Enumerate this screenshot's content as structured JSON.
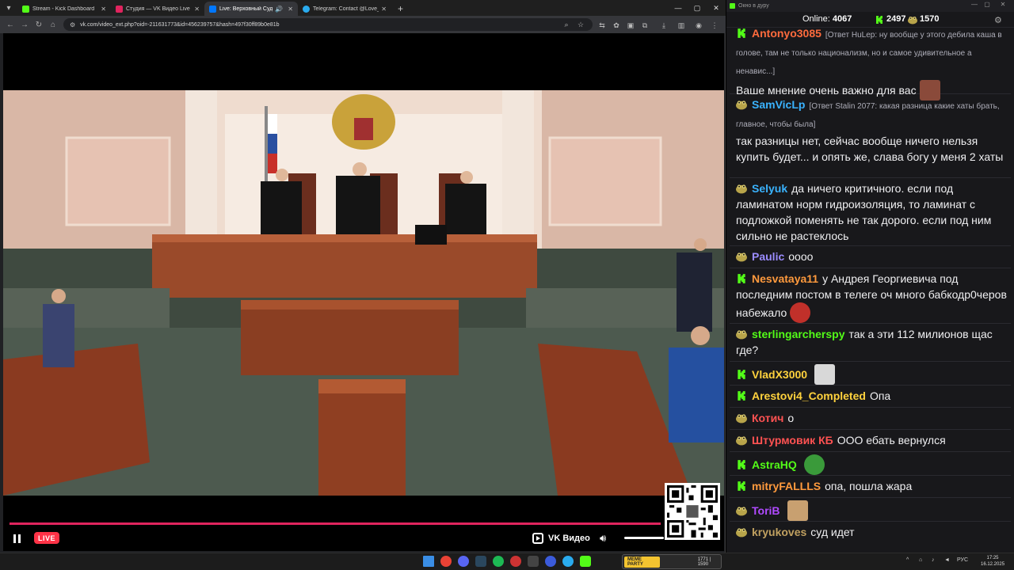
{
  "browser": {
    "tabs": [
      {
        "title": "Stream - Kick Dashboard",
        "color": "#53fc18"
      },
      {
        "title": "Студия — VK Видео Live",
        "color": "#e0245e"
      },
      {
        "title": "Live: Верховный Суд Росс",
        "color": "#0077ff"
      },
      {
        "title": "Telegram: Contact @Love_Russ",
        "color": "#2aabee"
      }
    ],
    "url": "vk.com/video_ext.php?oid=-211631773&id=456239757&hash=497f30ff89b0e81b"
  },
  "video": {
    "live_label": "LIVE",
    "brand_label": "VK Видео",
    "is_live": true,
    "volume_level": 0.8
  },
  "chat": {
    "window_title": "Окно в дуру",
    "online_label": "Online:",
    "online_count": "4067",
    "kick_coins": "2497",
    "frog_coins": "1570",
    "messages": [
      {
        "badge": "kick",
        "user": "Antonyo3085",
        "color": "#ff6b3d",
        "reply": "[Ответ HuLep: ну вообще у этого дебила каша в голове, там не только национализм, но и самое удивительное а ненавис...]",
        "text": "Ваше мнение очень важно для вас",
        "emote": "face-emote"
      },
      {
        "badge": "frog",
        "user": "SamVicLp",
        "color": "#3ab3ff",
        "reply": "[Ответ Stalin 2077: какая разница какие хаты брать, главное, чтобы была]",
        "text": "так разницы нет, сейчас вообще ничего нельзя купить будет... и опять же, слава богу у меня 2 хаты"
      },
      {
        "badge": "frog",
        "user": "Selyuk",
        "color": "#3ab3ff",
        "text": "да ничего критичного. если под ламинатом норм гидроизоляция, то ламинат с подложкой поменять не так дорого. если под ним сильно не растеклось"
      },
      {
        "badge": "frog",
        "user": "Paulic",
        "color": "#9b8cff",
        "text": "оооо"
      },
      {
        "badge": "kick",
        "user": "Nesvataya11",
        "color": "#ff9a3d",
        "text": "у Андрея Георгиевича под последним постом в телеге оч много бабкодр0черов набежало",
        "emote": "red-emote"
      },
      {
        "badge": "frog",
        "user": "sterlingarcherspy",
        "color": "#53fc18",
        "text": "так а эти 112 милионов щас где?"
      },
      {
        "badge": "kick",
        "user": "VladX3000",
        "color": "#ffd23d",
        "text": "",
        "emote": "cat-emote"
      },
      {
        "badge": "kick",
        "user": "Arestovi4_Completed",
        "color": "#ffd23d",
        "text": "Опа"
      },
      {
        "badge": "frog",
        "user": "Котич",
        "color": "#ff5252",
        "text": "о"
      },
      {
        "badge": "frog",
        "user": "Штурмовик КБ",
        "color": "#ff5252",
        "text": "ООО ебать вернулся"
      },
      {
        "badge": "kick",
        "user": "AstraHQ",
        "color": "#53fc18",
        "text": "",
        "emote": "pepe-emote"
      },
      {
        "badge": "kick",
        "user": "mitryFALLLS",
        "color": "#ff9a3d",
        "text": "опа, пошла жара"
      },
      {
        "badge": "frog",
        "user": "ToriB",
        "color": "#b04aff",
        "text": "",
        "emote": "dog-emote"
      },
      {
        "badge": "frog",
        "user": "kryukoves",
        "color": "#c0a060",
        "text": "суд идет"
      }
    ]
  },
  "taskbar": {
    "meme_label": "MEME PARTY",
    "meme_stats": "1771 | 1590",
    "lang": "РУС",
    "time": "17:25",
    "date": "16.12.2025"
  }
}
